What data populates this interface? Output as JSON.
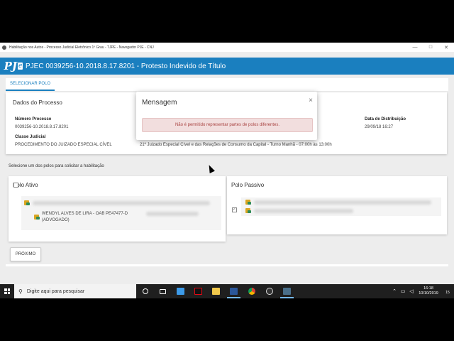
{
  "window": {
    "title": "Habilitação nos Autos - Processo Judicial Eletrônico 1º Grau - TJPE - Navegador PJE - CNJ",
    "minimize": "—",
    "maximize": "□",
    "close": "✕"
  },
  "app": {
    "logo_text": "PJ",
    "logo_e": "e",
    "heading": "PJEC 0039256-10.2018.8.17.8201 - Protesto Indevido de Título"
  },
  "tabs": [
    {
      "label": "SELECIONAR POLO"
    }
  ],
  "dados": {
    "title": "Dados do Processo",
    "numero_label": "Número Processo",
    "numero_value": "0039256-10.2018.8.17.8201",
    "classe_label": "Classe Judicial",
    "classe_value": "PROCEDIMENTO DO JUIZADO ESPECIAL CÍVEL",
    "orgao_value": "21º Juizado Especial Cível e das Relações de Consumo da Capital - Turno Manhã - 07:00h às 13:00h",
    "distribuicao_label": "Data de Distribuição",
    "distribuicao_value": "29/09/18 16:27"
  },
  "instruction": "Selecione um dos polos para solicitar a habilitação",
  "polo_ativo": {
    "title": "Polo Ativo",
    "advogado_line1": "WENDYL ALVES DE LIRA - OAB PE47477-D",
    "advogado_line2": "(ADVOGADO)"
  },
  "polo_passivo": {
    "title": "Polo Passivo",
    "check_mark": "✓"
  },
  "button_proximo": "PRÓXIMO",
  "modal": {
    "title": "Mensagem",
    "close": "×",
    "message": "Não é permitido representar partes de polos diferentes."
  },
  "taskbar": {
    "search_placeholder": "Digite aqui para pesquisar",
    "time": "16:18",
    "date": "10/10/2019",
    "notification_count": "15"
  },
  "colors": {
    "brand": "#1a7fbf",
    "alert_bg": "#f2dede",
    "alert_text": "#a94442"
  }
}
